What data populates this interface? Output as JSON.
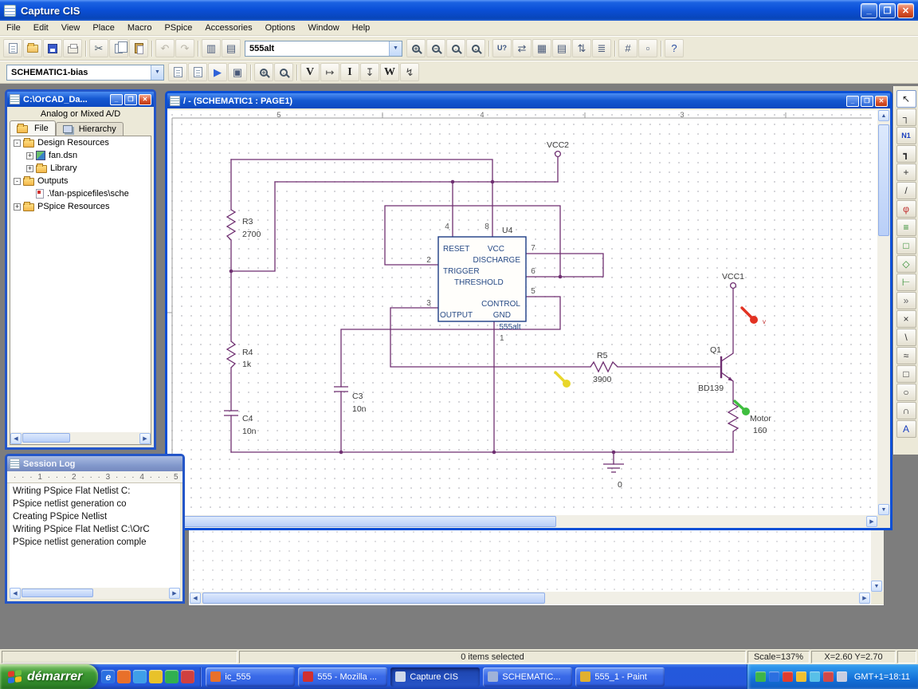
{
  "colors": {
    "wire": "#6f2f71",
    "part_outline": "#1d3c85",
    "pin_text": "#274a86",
    "label": "#3a3a3a",
    "probe_red": "#e23222",
    "probe_yellow": "#e8d62a",
    "probe_green": "#3fbe3f"
  },
  "app": {
    "title": "Capture CIS"
  },
  "menubar": [
    "File",
    "Edit",
    "View",
    "Place",
    "Macro",
    "PSpice",
    "Accessories",
    "Options",
    "Window",
    "Help"
  ],
  "toolbar_main": {
    "items": [
      {
        "t": "btn",
        "name": "new-document",
        "icon": "paper"
      },
      {
        "t": "btn",
        "name": "open-document",
        "icon": "folder-open"
      },
      {
        "t": "btn",
        "name": "save-document",
        "icon": "floppy"
      },
      {
        "t": "btn",
        "name": "print",
        "icon": "printer"
      },
      {
        "t": "sep"
      },
      {
        "t": "btn",
        "name": "cut",
        "g": "✂",
        "c": "#4a5a6a"
      },
      {
        "t": "btn",
        "name": "copy",
        "icon": "copy"
      },
      {
        "t": "btn",
        "name": "paste",
        "icon": "paste"
      },
      {
        "t": "sep"
      },
      {
        "t": "btn",
        "name": "undo",
        "g": "↶",
        "c": "#b9b5a9"
      },
      {
        "t": "btn",
        "name": "redo",
        "g": "↷",
        "c": "#b9b5a9"
      },
      {
        "t": "sep"
      },
      {
        "t": "btn",
        "name": "view-previous",
        "g": "▥",
        "c": "#4a5a7a"
      },
      {
        "t": "btn",
        "name": "view-next",
        "g": "▤",
        "c": "#4a5a7a"
      },
      {
        "t": "combo",
        "name": "part-combo",
        "value": "555alt"
      },
      {
        "t": "btn",
        "name": "zoom-in",
        "icon": "mag-plus"
      },
      {
        "t": "btn",
        "name": "zoom-out",
        "icon": "mag-minus"
      },
      {
        "t": "btn",
        "name": "zoom-area",
        "icon": "mag-area"
      },
      {
        "t": "btn",
        "name": "zoom-all",
        "icon": "mag-all"
      },
      {
        "t": "sep"
      },
      {
        "t": "btn",
        "name": "annotate",
        "g": "U?",
        "c": "#37507f",
        "small": true
      },
      {
        "t": "btn",
        "name": "back-annotate",
        "g": "⇄",
        "c": "#4a5a7a"
      },
      {
        "t": "btn",
        "name": "design-rule-check",
        "g": "▦",
        "c": "#4a5a7a"
      },
      {
        "t": "btn",
        "name": "create-netlist",
        "g": "▤",
        "c": "#4a5a7a"
      },
      {
        "t": "btn",
        "name": "cross-reference",
        "g": "⇅",
        "c": "#4a5a7a"
      },
      {
        "t": "btn",
        "name": "bill-of-materials",
        "g": "≣",
        "c": "#4a5a7a"
      },
      {
        "t": "sep"
      },
      {
        "t": "btn",
        "name": "snap-to-grid",
        "g": "#",
        "c": "#4a5a7a"
      },
      {
        "t": "btn",
        "name": "project-manager",
        "g": "▫",
        "c": "#4a5a7a"
      },
      {
        "t": "sep"
      },
      {
        "t": "btn",
        "name": "help",
        "g": "?",
        "c": "#2a4da0"
      }
    ]
  },
  "toolbar_pspice": {
    "items": [
      {
        "t": "combo",
        "name": "simulation-profile-combo",
        "value": "SCHEMATIC1-bias"
      },
      {
        "t": "btn",
        "name": "new-simulation-profile",
        "icon": "paper"
      },
      {
        "t": "btn",
        "name": "edit-simulation-profile",
        "icon": "paper"
      },
      {
        "t": "btn",
        "name": "run-pspice",
        "g": "▶",
        "c": "#2f62d8"
      },
      {
        "t": "btn",
        "name": "view-simulation-results",
        "g": "▣",
        "c": "#4a5a7a"
      },
      {
        "t": "sep"
      },
      {
        "t": "btn",
        "name": "view-netlist",
        "icon": "mag-plus"
      },
      {
        "t": "btn",
        "name": "view-output-file",
        "icon": "mag-area"
      },
      {
        "t": "sep"
      },
      {
        "t": "btn",
        "name": "voltage-level-marker",
        "g": "V",
        "serif": true
      },
      {
        "t": "btn",
        "name": "voltage-differential-marker",
        "g": "↦",
        "c": "#444"
      },
      {
        "t": "btn",
        "name": "current-marker",
        "g": "I",
        "serif": true
      },
      {
        "t": "btn",
        "name": "current-into-pin-marker",
        "g": "↧",
        "c": "#444"
      },
      {
        "t": "btn",
        "name": "power-dissipation-marker",
        "g": "W",
        "serif": true
      },
      {
        "t": "btn",
        "name": "power-marker",
        "g": "↯",
        "c": "#444"
      }
    ]
  },
  "tool_palette": {
    "items": [
      {
        "name": "select-tool",
        "g": "↖",
        "c": "#222"
      },
      {
        "name": "place-wire-tool",
        "g": "┐",
        "c": "#333"
      },
      {
        "name": "place-net-alias-tool",
        "g": "N1",
        "c": "#1a3fbf",
        "small": true
      },
      {
        "name": "place-bus-tool",
        "g": "┓",
        "c": "#333"
      },
      {
        "name": "place-junction-tool",
        "g": "+",
        "c": "#333"
      },
      {
        "name": "place-bus-entry-tool",
        "g": "/",
        "c": "#333"
      },
      {
        "name": "place-power-tool",
        "g": "φ",
        "c": "#c03030"
      },
      {
        "name": "place-ground-tool",
        "g": "≡",
        "c": "#2e8b2e"
      },
      {
        "name": "place-hierarchical-block-tool",
        "g": "□",
        "c": "#2e8b2e"
      },
      {
        "name": "place-port-tool",
        "g": "◇",
        "c": "#2e8b2e"
      },
      {
        "name": "place-pin-tool",
        "g": "⊢",
        "c": "#2e8b2e"
      },
      {
        "name": "place-off-page-connector-tool",
        "g": "»",
        "c": "#666"
      },
      {
        "name": "place-no-connect-tool",
        "g": "×",
        "c": "#333"
      },
      {
        "name": "place-line-tool",
        "g": "\\",
        "c": "#333"
      },
      {
        "name": "place-polyline-tool",
        "g": "≈",
        "c": "#333"
      },
      {
        "name": "place-rectangle-tool",
        "g": "□",
        "c": "#333"
      },
      {
        "name": "place-ellipse-tool",
        "g": "○",
        "c": "#333"
      },
      {
        "name": "place-arc-tool",
        "g": "∩",
        "c": "#333"
      },
      {
        "name": "place-text-tool",
        "g": "A",
        "c": "#1a3fbf"
      }
    ]
  },
  "project_manager": {
    "title": "C:\\OrCAD_Da...",
    "mode_label": "Analog or Mixed A/D",
    "tabs": [
      {
        "label": "File"
      },
      {
        "label": "Hierarchy"
      }
    ],
    "tree": [
      {
        "label": "Design Resources",
        "level": 0,
        "expand": "-",
        "icon": "folder"
      },
      {
        "label": "fan.dsn",
        "level": 1,
        "expand": "+",
        "icon": "design"
      },
      {
        "label": "Library",
        "level": 1,
        "expand": "+",
        "icon": "folder"
      },
      {
        "label": "Outputs",
        "level": 0,
        "expand": "-",
        "icon": "folder"
      },
      {
        "label": ".\\fan-pspicefiles\\sche",
        "level": 1,
        "expand": "",
        "icon": "netlist"
      },
      {
        "label": "PSpice Resources",
        "level": 0,
        "expand": "+",
        "icon": "folder"
      }
    ]
  },
  "session_log": {
    "title": "Session Log",
    "ruler": "· · · 1 · · · 2 · · · 3 · · · 4 · · · 5",
    "lines": [
      "Writing PSpice Flat Netlist C:",
      "PSpice netlist generation co",
      "Creating PSpice Netlist",
      "Writing PSpice Flat Netlist C:\\OrC",
      "PSpice netlist generation comple"
    ]
  },
  "schematic": {
    "window_title": "/ - (SCHEMATIC1 : PAGE1)",
    "zones": [
      "5",
      "4",
      "3"
    ],
    "power": {
      "vcc2": "VCC2",
      "vcc1": "VCC1",
      "gnd_ref": "0"
    },
    "u4": {
      "ref": "U4",
      "value": "555alt",
      "pin_labels": {
        "reset": "RESET",
        "vcc": "VCC",
        "discharge": "DISCHARGE",
        "trigger": "TRIGGER",
        "threshold": "THRESHOLD",
        "control": "CONTROL",
        "output": "OUTPUT",
        "gnd": "GND"
      },
      "pin_numbers": {
        "n1": "1",
        "n2": "2",
        "n3": "3",
        "n4": "4",
        "n5": "5",
        "n6": "6",
        "n7": "7",
        "n8": "8"
      }
    },
    "parts": {
      "r3_ref": "R3",
      "r3_val": "2700",
      "r4_ref": "R4",
      "r4_val": "1k",
      "r5_ref": "R5",
      "r5_val": "3900",
      "c3_ref": "C3",
      "c3_val": "10n",
      "c4_ref": "C4",
      "c4_val": "10n",
      "q1_ref": "Q1",
      "q1_val": "BD139",
      "motor_ref": "Motor",
      "motor_val": "160"
    },
    "marker_note": "v"
  },
  "status_bar": {
    "selection": "0 items selected",
    "scale": "Scale=137%",
    "coords": "X=2.60 Y=2.70"
  },
  "taskbar": {
    "start_label": "démarrer",
    "quick_launch": [
      {
        "name": "internet-explorer-icon",
        "g": "e",
        "bg": "#2b6fe0"
      },
      {
        "name": "firefox-icon",
        "g": "",
        "bg": "#e8702a"
      },
      {
        "name": "desktop-icon",
        "g": "",
        "bg": "#3f9fe8"
      },
      {
        "name": "email-icon",
        "g": "",
        "bg": "#e8c22a"
      },
      {
        "name": "media-player-icon",
        "g": "",
        "bg": "#30b050"
      },
      {
        "name": "messenger-icon",
        "g": "",
        "bg": "#d04040"
      }
    ],
    "tasks": [
      {
        "label": "ic_555",
        "icon_bg": "#e8702a",
        "active": false
      },
      {
        "label": "555 - Mozilla ...",
        "icon_bg": "#d03030",
        "active": false
      },
      {
        "label": "Capture CIS",
        "icon_bg": "#cfd8ea",
        "active": true
      },
      {
        "label": "SCHEMATIC...",
        "icon_bg": "#9fb2d8",
        "active": false
      },
      {
        "label": "555_1 - Paint",
        "icon_bg": "#e0b030",
        "active": false
      }
    ],
    "tray_icons": [
      "#3db54a",
      "#2b6fe0",
      "#e03c2e",
      "#f0c030",
      "#58c0e8",
      "#d04848",
      "#c8cde0"
    ],
    "clock": "GMT+1=18:11"
  }
}
